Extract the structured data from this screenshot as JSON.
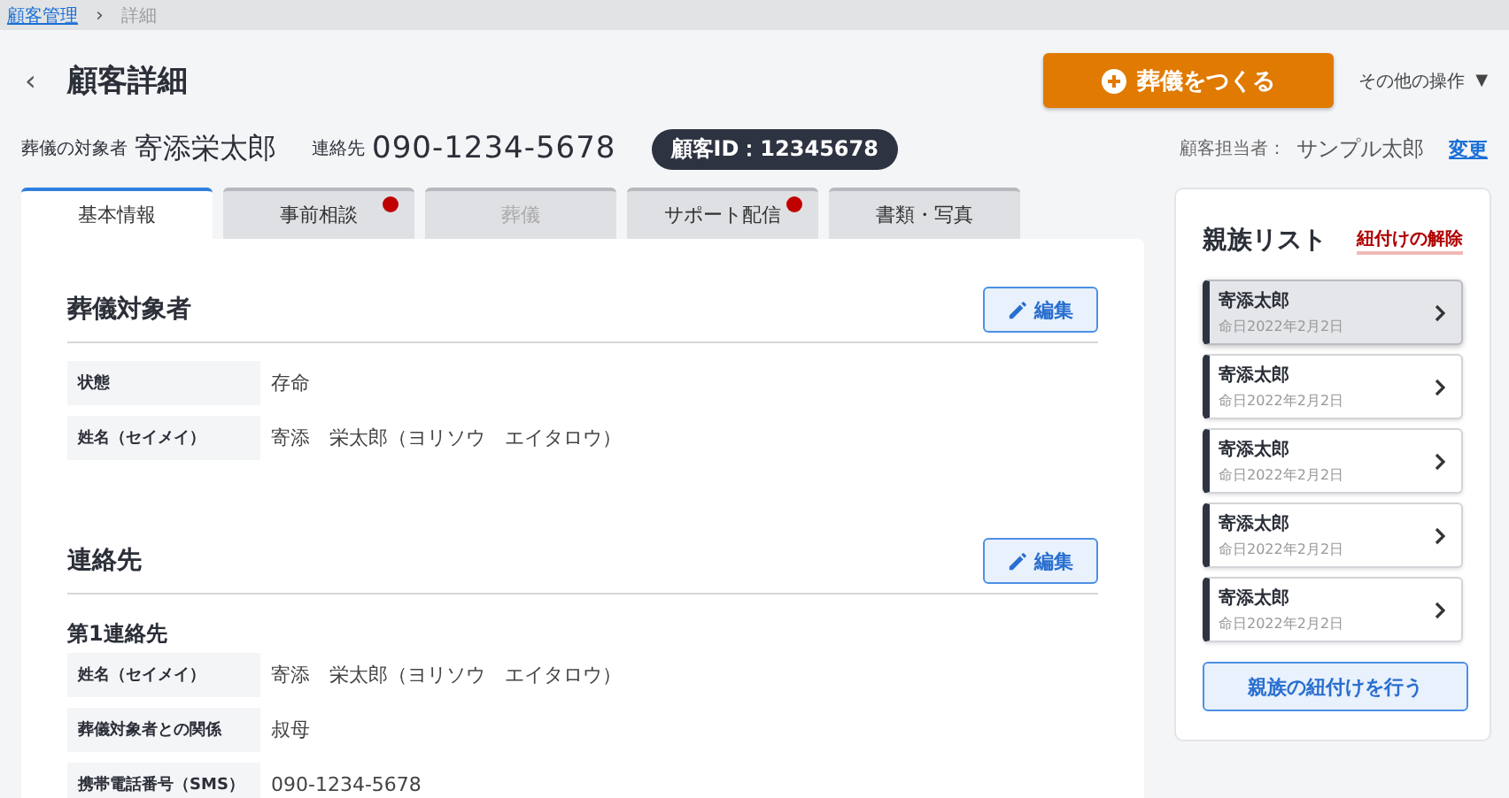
{
  "breadcrumb": {
    "items": [
      {
        "label": "顧客管理",
        "link": true
      },
      {
        "label": "詳細",
        "link": false
      }
    ],
    "separator": "›"
  },
  "header": {
    "back": "‹",
    "title": "顧客詳細",
    "primary_button": "葬儀をつくる",
    "more_menu": "その他の操作",
    "more_caret": "▼"
  },
  "summary": {
    "subject_label": "葬儀の対象者",
    "subject_name": "寄添栄太郎",
    "contact_label": "連絡先",
    "contact_value": "090-1234-5678",
    "customer_id": "顧客ID：12345678",
    "owner_label": "顧客担当者：",
    "owner_name": "サンプル太郎",
    "owner_change": "変更"
  },
  "tabs": [
    {
      "label": "基本情報",
      "selected": true,
      "disabled": false,
      "dot": false
    },
    {
      "label": "事前相談",
      "selected": false,
      "disabled": false,
      "dot": true
    },
    {
      "label": "葬儀",
      "selected": false,
      "disabled": true,
      "dot": false
    },
    {
      "label": "サポート配信",
      "selected": false,
      "disabled": false,
      "dot": true
    },
    {
      "label": "書類・写真",
      "selected": false,
      "disabled": false,
      "dot": false
    }
  ],
  "sections": [
    {
      "title": "葬儀対象者",
      "edit_button": "編集",
      "groups": [
        {
          "rows": [
            {
              "label": "状態",
              "value": "存命"
            },
            {
              "label": "姓名（セイメイ）",
              "value": "寄添　栄太郎（ヨリソウ　エイタロウ）"
            }
          ]
        }
      ]
    },
    {
      "title": "連絡先",
      "edit_button": "編集",
      "groups": [
        {
          "subtitle": "第1連絡先",
          "rows": [
            {
              "label": "姓名（セイメイ）",
              "value": "寄添　栄太郎（ヨリソウ　エイタロウ）"
            },
            {
              "label": "葬儀対象者との関係",
              "value": "叔母"
            },
            {
              "label": "携帯電話番号（SMS）",
              "value": "090-1234-5678"
            }
          ]
        }
      ]
    }
  ],
  "relatives": {
    "title": "親族リスト",
    "unlink": "紐付けの解除",
    "items": [
      {
        "name": "寄添太郎",
        "date": "命日2022年2月2日",
        "selected": true
      },
      {
        "name": "寄添太郎",
        "date": "命日2022年2月2日",
        "selected": false
      },
      {
        "name": "寄添太郎",
        "date": "命日2022年2月2日",
        "selected": false
      },
      {
        "name": "寄添太郎",
        "date": "命日2022年2月2日",
        "selected": false
      },
      {
        "name": "寄添太郎",
        "date": "命日2022年2月2日",
        "selected": false
      }
    ],
    "link_button": "親族の紐付けを行う"
  }
}
